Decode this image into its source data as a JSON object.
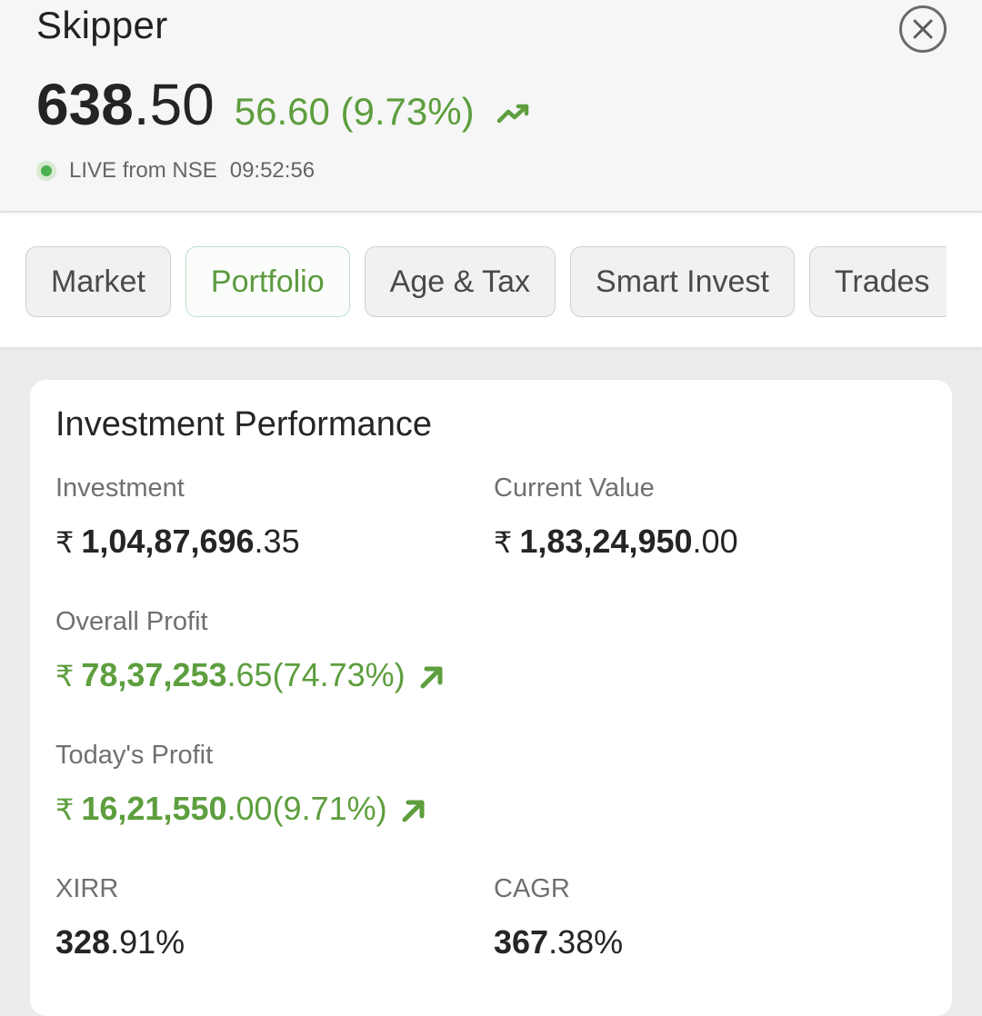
{
  "header": {
    "stock_name": "Skipper",
    "price_int": "638",
    "price_dec": ".50",
    "change_text": "56.60 (9.73%)",
    "trend_icon": "trending-up-icon",
    "live_label": "LIVE from NSE",
    "live_time": "09:52:56",
    "close_icon": "close-icon"
  },
  "tabs": [
    {
      "label": "Market",
      "active": false
    },
    {
      "label": "Portfolio",
      "active": true
    },
    {
      "label": "Age & Tax",
      "active": false
    },
    {
      "label": "Smart Invest",
      "active": false
    },
    {
      "label": "Trades",
      "active": false
    }
  ],
  "card": {
    "title": "Investment Performance",
    "investment": {
      "label": "Investment",
      "currency": "₹",
      "int": "1,04,87,696",
      "dec": ".35"
    },
    "current_value": {
      "label": "Current Value",
      "currency": "₹",
      "int": "1,83,24,950",
      "dec": ".00"
    },
    "overall_profit": {
      "label": "Overall Profit",
      "currency": "₹",
      "int": "78,37,253",
      "dec": ".65",
      "pct": " (74.73%)",
      "icon": "arrow-up-right-icon"
    },
    "todays_profit": {
      "label": "Today's Profit",
      "currency": "₹",
      "int": "16,21,550",
      "dec": ".00",
      "pct": " (9.71%)",
      "icon": "arrow-up-right-icon"
    },
    "xirr": {
      "label": "XIRR",
      "int": "328",
      "dec": ".91%"
    },
    "cagr": {
      "label": "CAGR",
      "int": "367",
      "dec": ".38%"
    }
  },
  "colors": {
    "positive_green": "#5d9e3e",
    "live_dot": "#4caf50",
    "active_tab_border": "#bde0cf"
  }
}
